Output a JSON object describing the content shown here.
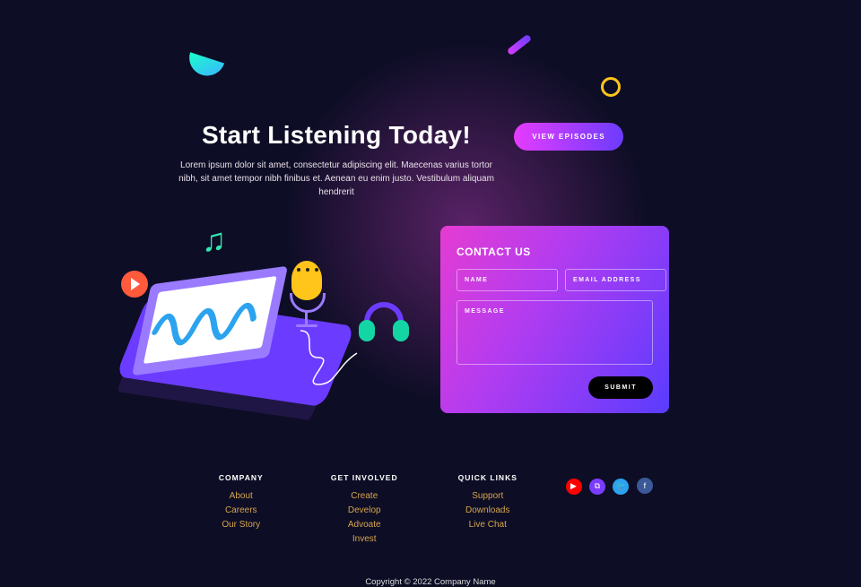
{
  "hero": {
    "heading": "Start Listening Today!",
    "subheading": "Lorem ipsum dolor sit amet, consectetur adipiscing elit. Maecenas varius tortor nibh, sit amet tempor nibh finibus et. Aenean eu enim justo. Vestibulum aliquam hendrerit",
    "cta_label": "VIEW EPISODES"
  },
  "contact": {
    "title": "CONTACT US",
    "name_placeholder": "NAME",
    "email_placeholder": "EMAIL ADDRESS",
    "message_placeholder": "MESSAGE",
    "submit_label": "SUBMIT"
  },
  "footer": {
    "cols": [
      {
        "heading": "COMPANY",
        "links": [
          "About",
          "Careers",
          "Our Story"
        ]
      },
      {
        "heading": "GET INVOLVED",
        "links": [
          "Create",
          "Develop",
          "Advoate",
          "Invest"
        ]
      },
      {
        "heading": "QUICK LINKS",
        "links": [
          "Support",
          "Downloads",
          "Live Chat"
        ]
      }
    ],
    "copyright": "Copyright © 2022 Company Name"
  },
  "icons": {
    "youtube": "▶",
    "twitch": "⧉",
    "twitter": "🐦",
    "facebook": "f"
  }
}
